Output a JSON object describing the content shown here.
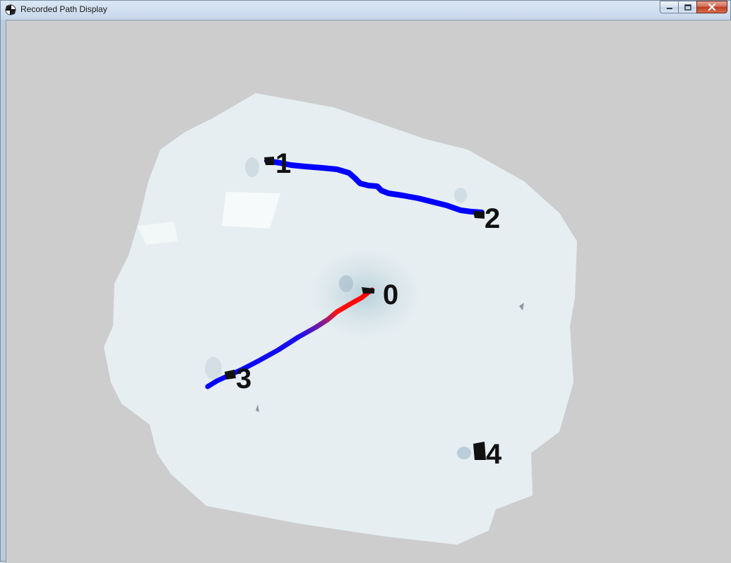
{
  "window": {
    "title": "Recorded Path Display",
    "icon": "app-icon",
    "controls": {
      "minimize": "minimize-icon",
      "maximize": "maximize-icon",
      "close": "close-icon"
    }
  },
  "map": {
    "waypoints": [
      {
        "id": "0",
        "label": "0"
      },
      {
        "id": "1",
        "label": "1"
      },
      {
        "id": "2",
        "label": "2"
      },
      {
        "id": "3",
        "label": "3"
      },
      {
        "id": "4",
        "label": "4"
      }
    ],
    "path_colors": {
      "primary": "#0000ff",
      "recent": "#ff0000"
    }
  }
}
